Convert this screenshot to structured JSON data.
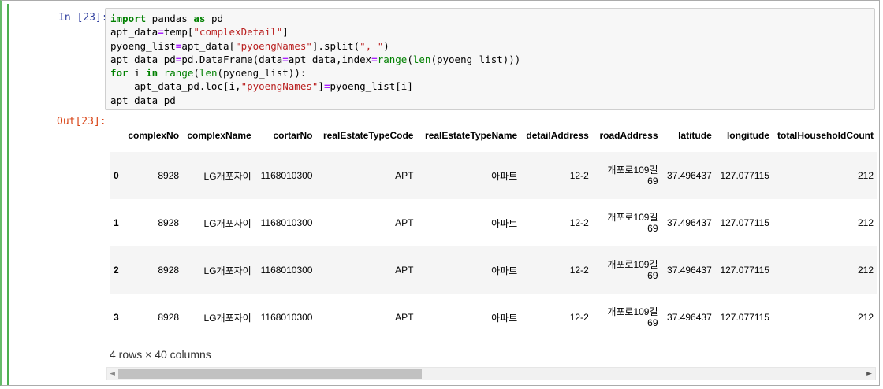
{
  "input_prompt": "In [23]:",
  "output_prompt": "Out[23]:",
  "code": {
    "line1": {
      "kw1": "import",
      "mid": " pandas ",
      "kw2": "as",
      "end": " pd"
    },
    "line2": {
      "pre": "apt_data",
      "op": "=",
      "mid": "temp[",
      "str": "\"complexDetail\"",
      "end": "]"
    },
    "line3": {
      "pre": "pyoeng_list",
      "op": "=",
      "mid": "apt_data[",
      "str1": "\"pyoengNames\"",
      "mid2": "].split(",
      "str2": "\", \"",
      "end": ")"
    },
    "line4": {
      "pre": "apt_data_pd",
      "op1": "=",
      "mid1": "pd.DataFrame(data",
      "op2": "=",
      "mid2": "apt_data,index",
      "op3": "=",
      "bi1": "range",
      "p1": "(",
      "bi2": "len",
      "p2": "(pyoeng_",
      "end": "list)))"
    },
    "line5": {
      "kw1": "for",
      "mid1": " i ",
      "kw2": "in",
      "sp": " ",
      "bi1": "range",
      "p1": "(",
      "bi2": "len",
      "end": "(pyoeng_list)):"
    },
    "line6": {
      "pre": "    apt_data_pd.loc[i,",
      "str": "\"pyoengNames\"",
      "mid": "]",
      "op": "=",
      "end": "pyoeng_list[i]"
    },
    "line7": "apt_data_pd"
  },
  "table": {
    "columns": [
      "complexNo",
      "complexName",
      "cortarNo",
      "realEstateTypeCode",
      "realEstateTypeName",
      "detailAddress",
      "roadAddress",
      "latitude",
      "longitude",
      "totalHouseholdCount"
    ],
    "rows": [
      {
        "index": "0",
        "cells": [
          "8928",
          "LG개포자이",
          "1168010300",
          "APT",
          "아파트",
          "12-2",
          "개포로109길",
          "69",
          "37.496437",
          "127.077115",
          "212"
        ]
      },
      {
        "index": "1",
        "cells": [
          "8928",
          "LG개포자이",
          "1168010300",
          "APT",
          "아파트",
          "12-2",
          "개포로109길",
          "69",
          "37.496437",
          "127.077115",
          "212"
        ]
      },
      {
        "index": "2",
        "cells": [
          "8928",
          "LG개포자이",
          "1168010300",
          "APT",
          "아파트",
          "12-2",
          "개포로109길",
          "69",
          "37.496437",
          "127.077115",
          "212"
        ]
      },
      {
        "index": "3",
        "cells": [
          "8928",
          "LG개포자이",
          "1168010300",
          "APT",
          "아파트",
          "12-2",
          "개포로109길",
          "69",
          "37.496437",
          "127.077115",
          "212"
        ]
      }
    ]
  },
  "rows_info": "4 rows × 40 columns",
  "scroll_left_arrow": "◄",
  "scroll_right_arrow": "►",
  "colors": {
    "cell_border_active": "#4caf50",
    "in_prompt": "#303f9f",
    "out_prompt": "#d84315",
    "keyword": "#008000",
    "string": "#ba2121",
    "operator": "#aa22ff"
  }
}
